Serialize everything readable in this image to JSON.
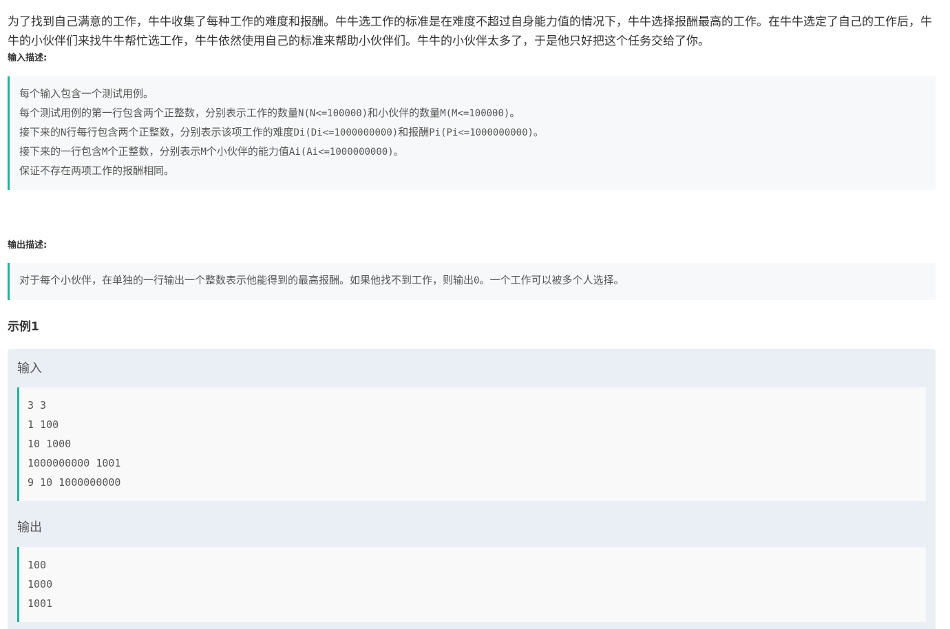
{
  "problem": {
    "intro_text": "为了找到自己满意的工作，牛牛收集了每种工作的难度和报酬。牛牛选工作的标准是在难度不超过自身能力值的情况下，牛牛选择报酬最高的工作。在牛牛选定了自己的工作后，牛牛的小伙伴们来找牛牛帮忙选工作，牛牛依然使用自己的标准来帮助小伙伴们。牛牛的小伙伴太多了，于是他只好把这个任务交给了你。",
    "input_label": "输入描述:",
    "input_lines": [
      [
        "每个输入包含一个测试用例。"
      ],
      [
        "每个测试用例的第一行包含两个正整数，分别表示工作的数量",
        "N(N<=100000)",
        "和小伙伴的数量",
        "M(M<=100000)",
        "。"
      ],
      [
        "接下来的",
        "N",
        "行每行包含两个正整数，分别表示该项工作的难度",
        "Di(Di<=1000000000)",
        "和报酬",
        "Pi(Pi<=1000000000)",
        "。"
      ],
      [
        "接下来的一行包含",
        "M",
        "个正整数，分别表示",
        "M",
        "个小伙伴的能力值",
        "Ai(Ai<=1000000000)",
        "。"
      ],
      [
        "保证不存在两项工作的报酬相同。"
      ]
    ],
    "output_label": "输出描述:",
    "output_lines": [
      [
        "对于每个小伙伴，在单独的一行输出一个整数表示他能得到的最高报酬。如果他找不到工作，则输出",
        "0",
        "。一个工作可以被多个人选择。"
      ]
    ]
  },
  "example": {
    "title": "示例1",
    "input_label": "输入",
    "input_lines": [
      "3 3",
      "1 100",
      "10 1000",
      "1000000000 1001",
      "9 10 1000000000"
    ],
    "output_label": "输出",
    "output_lines": [
      "100",
      "1000",
      "1001"
    ]
  }
}
